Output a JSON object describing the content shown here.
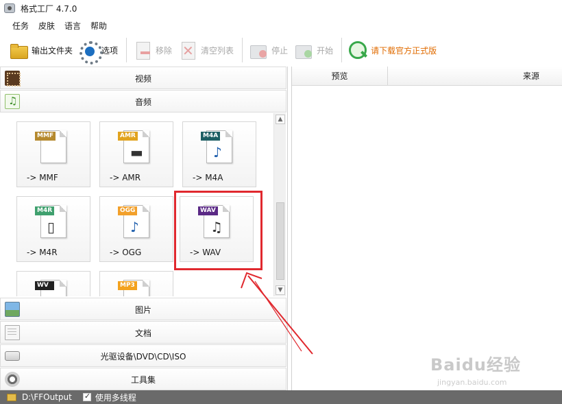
{
  "window": {
    "title": "格式工厂 4.7.0"
  },
  "menu": [
    "任务",
    "皮肤",
    "语言",
    "帮助"
  ],
  "toolbar": {
    "output_folder": "输出文件夹",
    "options": "选项",
    "remove": "移除",
    "clear_list": "清空列表",
    "stop": "停止",
    "start": "开始",
    "download_official": "请下载官方正式版"
  },
  "categories": {
    "video": "视频",
    "audio": "音频",
    "image": "图片",
    "document": "文档",
    "optical": "光驱设备\\DVD\\CD\\ISO",
    "tools": "工具集"
  },
  "audio_formats": [
    {
      "badge": "MMF",
      "label": "-> MMF",
      "glyph": ""
    },
    {
      "badge": "AMR",
      "label": "-> AMR",
      "glyph": "▬"
    },
    {
      "badge": "M4A",
      "label": "-> M4A",
      "glyph": "♪"
    },
    {
      "badge": "M4R",
      "label": "-> M4R",
      "glyph": "▯"
    },
    {
      "badge": "OGG",
      "label": "-> OGG",
      "glyph": "♪"
    },
    {
      "badge": "WAV",
      "label": "-> WAV",
      "glyph": "♫"
    },
    {
      "badge": "WV",
      "label": "",
      "glyph": ""
    },
    {
      "badge": "MP3",
      "label": "",
      "glyph": ""
    }
  ],
  "file_list": {
    "col_preview": "预览",
    "col_source": "来源"
  },
  "status": {
    "output_path": "D:\\FFOutput",
    "multithread": "使用多线程"
  },
  "watermark": {
    "brand": "Baidu经验",
    "url": "jingyan.baidu.com"
  },
  "colors": {
    "highlight": "#e0282e",
    "accent_text": "#e06b00",
    "status_bar": "#6a6a6a"
  }
}
